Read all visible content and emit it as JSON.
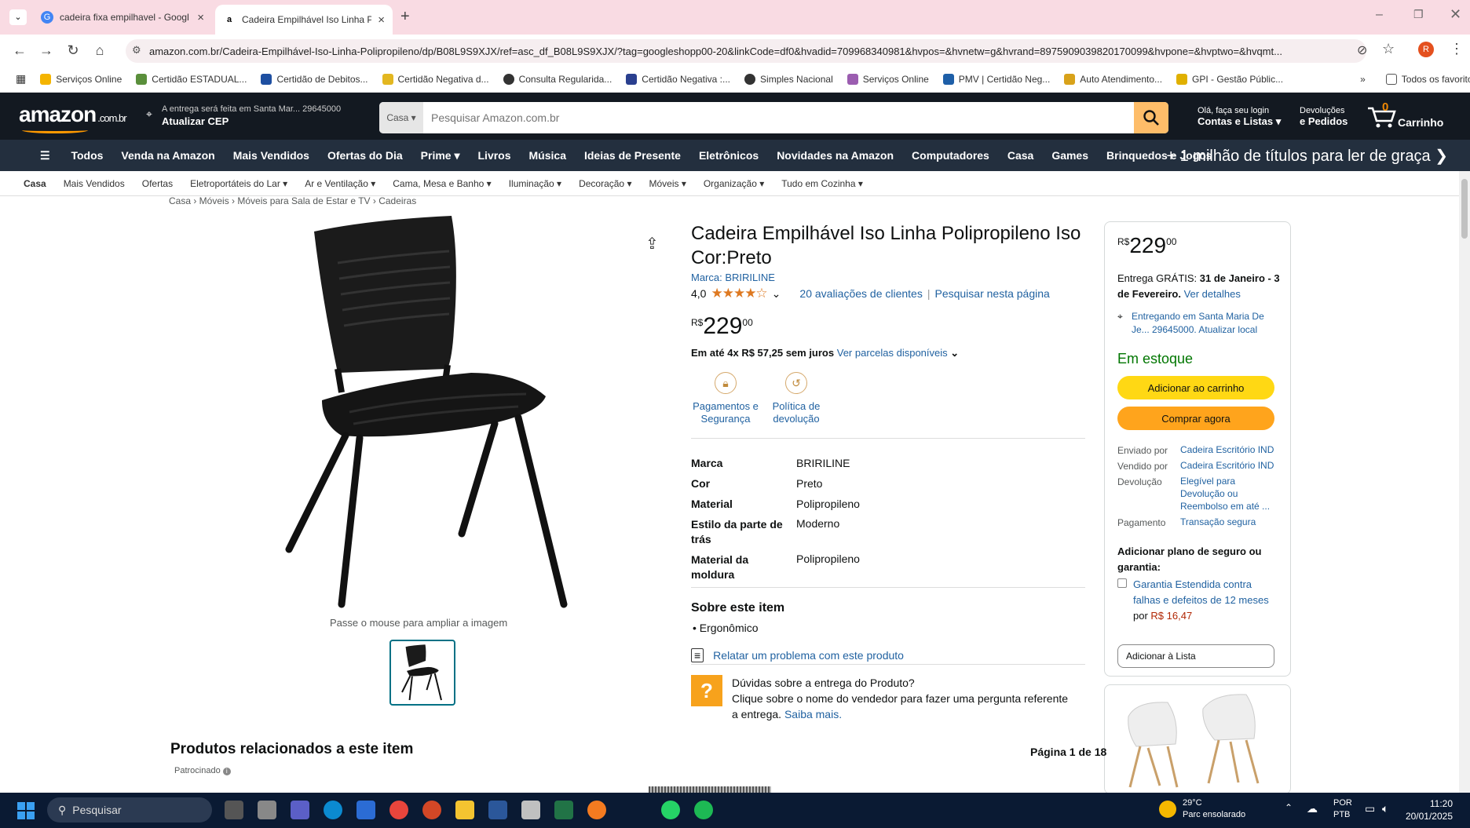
{
  "browser": {
    "tabs": [
      {
        "title": "cadeira fixa empilhavel - Googl",
        "active": false
      },
      {
        "title": "Cadeira Empilhável Iso Linha P",
        "active": true
      }
    ],
    "new_tab": "+",
    "url": "amazon.com.br/Cadeira-Empilhável-Iso-Linha-Polipropileno/dp/B08L9S9XJX/ref=asc_df_B08L9S9XJX/?tag=googleshopp00-20&linkCode=df0&hvadid=709968340981&hvpos=&hvnetw=g&hvrand=8975909039820170099&hvpone=&hvptwo=&hvqmt...",
    "bookmarks": [
      "Serviços Online",
      "Certidão ESTADUAL...",
      "Certidão de Debitos...",
      "Certidão Negativa d...",
      "Consulta Regularida...",
      "Certidão Negativa :...",
      "Simples Nacional",
      "Serviços Online",
      "PMV | Certidão Neg...",
      "Auto Atendimento...",
      "GPI - Gestão Públic..."
    ],
    "bookmarks_more": "»",
    "all_favorites": "Todos os favoritos"
  },
  "header": {
    "logo": "amazon",
    "logo_suffix": ".com.br",
    "deliver_line1": "A entrega será feita em Santa Mar... 29645000",
    "deliver_line2": "Atualizar CEP",
    "search_category": "Casa ▾",
    "search_placeholder": "Pesquisar Amazon.com.br",
    "account_line1": "Olá, faça seu login",
    "account_line2": "Contas e Listas ▾",
    "returns_line1": "Devoluções",
    "returns_line2": "e Pedidos",
    "cart_count": "0",
    "cart_label": "Carrinho"
  },
  "nav": {
    "all": "Todos",
    "items": [
      "Venda na Amazon",
      "Mais Vendidos",
      "Ofertas do Dia",
      "Prime ▾",
      "Livros",
      "Música",
      "Ideias de Presente",
      "Eletrônicos",
      "Novidades na Amazon",
      "Computadores",
      "Casa",
      "Games",
      "Brinquedos e Jogos"
    ],
    "promo": "+ 1 milhão de títulos para ler de graça ❯"
  },
  "subnav": [
    "Casa",
    "Mais Vendidos",
    "Ofertas",
    "Eletroportáteis do Lar ▾",
    "Ar e Ventilação ▾",
    "Cama, Mesa e Banho ▾",
    "Iluminação ▾",
    "Decoração ▾",
    "Móveis ▾",
    "Organização ▾",
    "Tudo em Cozinha ▾"
  ],
  "breadcrumb": "Casa › Móveis › Móveis para Sala de Estar e TV › Cadeiras",
  "image": {
    "zoom_hint": "Passe o mouse para ampliar a imagem"
  },
  "product": {
    "title": "Cadeira Empilhável Iso Linha Polipropileno Iso Cor:Preto",
    "brand_link": "Marca: BRIRILINE",
    "rating": "4,0",
    "stars": "★★★★☆",
    "reviews": "20 avaliações de clientes",
    "search_page": "Pesquisar nesta página",
    "price_symbol": "R$",
    "price_int": "229",
    "price_cents": "00",
    "installments": "Em até 4x R$ 57,25 sem juros",
    "installments_link": "Ver parcelas disponíveis",
    "badge1": "Pagamentos e Segurança",
    "badge2": "Política de devolução",
    "specs": [
      {
        "k": "Marca",
        "v": "BRIRILINE"
      },
      {
        "k": "Cor",
        "v": "Preto"
      },
      {
        "k": "Material",
        "v": "Polipropileno"
      },
      {
        "k": "Estilo da parte de trás",
        "v": "Moderno"
      },
      {
        "k": "Material da moldura",
        "v": "Polipropileno"
      }
    ],
    "about_title": "Sobre este item",
    "about_items": [
      "Ergonômico"
    ],
    "report": "Relatar um problema com este produto",
    "question_title": "Dúvidas sobre a entrega do Produto?",
    "question_text": "Clique sobre o nome do vendedor para fazer uma pergunta referente a entrega.",
    "question_link": "Saiba mais."
  },
  "buybox": {
    "delivery_prefix": "Entrega GRÁTIS:",
    "delivery_date": "31 de Janeiro - 3 de Fevereiro.",
    "delivery_link": "Ver detalhes",
    "location": "Entregando em Santa Maria De Je... 29645000. Atualizar local",
    "stock": "Em estoque",
    "add_cart": "Adicionar ao carrinho",
    "buy_now": "Comprar agora",
    "shipped_label": "Enviado por",
    "shipped_value": "Cadeira Escritório IND",
    "sold_label": "Vendido por",
    "sold_value": "Cadeira Escritório IND",
    "return_label": "Devolução",
    "return_value": "Elegível para Devolução ou Reembolso em até ...",
    "payment_label": "Pagamento",
    "payment_value": "Transação segura",
    "insurance_title": "Adicionar plano de seguro ou garantia:",
    "warranty_text": "Garantia Estendida contra falhas e defeitos de 12 meses",
    "warranty_por": "por",
    "warranty_price": "R$ 16,47",
    "add_list": "Adicionar à Lista"
  },
  "related": {
    "title": "Produtos relacionados a este item",
    "sponsored": "Patrocinado",
    "page": "Página 1 de 18"
  },
  "taskbar": {
    "search": "Pesquisar",
    "weather_temp": "29°C",
    "weather_text": "Parc ensolarado",
    "lang1": "POR",
    "lang2": "PTB",
    "time": "11:20",
    "date": "20/01/2025"
  },
  "colors": {
    "amazon_dark": "#131921",
    "amazon_nav": "#232f3e",
    "amazon_orange": "#ff9900",
    "add_cart": "#ffd814",
    "buy_now": "#ffa41c",
    "stock_green": "#007600",
    "price_red": "#b12704"
  }
}
